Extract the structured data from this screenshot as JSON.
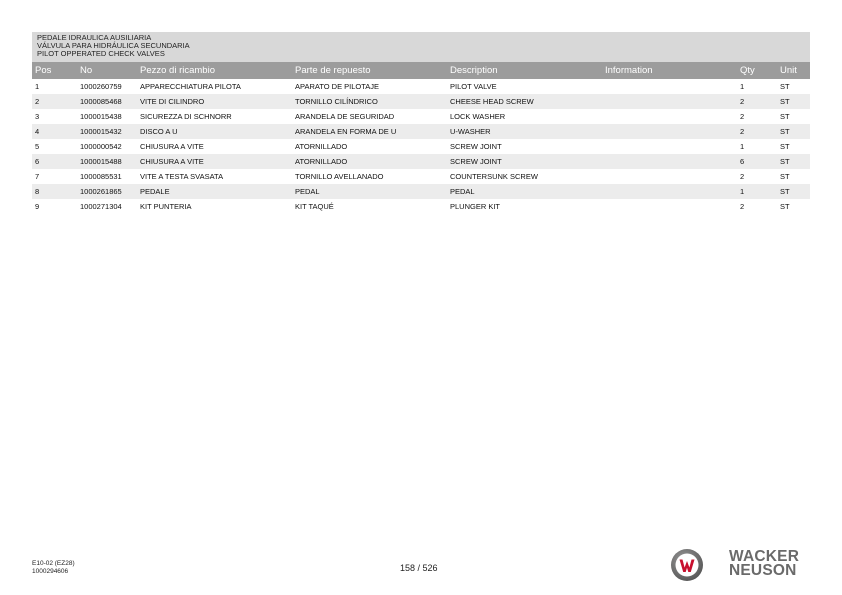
{
  "header": {
    "lines": [
      "PEDALE IDRAULICA AUSILIARIA",
      "VÁLVULA PARA HIDRÁULICA SECUNDARIA",
      "PILOT OPPERATED CHECK VALVES"
    ]
  },
  "table": {
    "columns": [
      "Pos",
      "No",
      "Pezzo di ricambio",
      "Parte de repuesto",
      "Description",
      "Information",
      "Qty",
      "Unit"
    ],
    "rows": [
      {
        "pos": "1",
        "no": "1000260759",
        "it": "APPARECCHIATURA PILOTA",
        "es": "APARATO DE PILOTAJE",
        "en": "PILOT VALVE",
        "info": "",
        "qty": "1",
        "unit": "ST"
      },
      {
        "pos": "2",
        "no": "1000085468",
        "it": "VITE DI CILINDRO",
        "es": "TORNILLO CILÍNDRICO",
        "en": "CHEESE HEAD SCREW",
        "info": "",
        "qty": "2",
        "unit": "ST"
      },
      {
        "pos": "3",
        "no": "1000015438",
        "it": "SICUREZZA DI SCHNORR",
        "es": "ARANDELA DE SEGURIDAD",
        "en": "LOCK WASHER",
        "info": "",
        "qty": "2",
        "unit": "ST"
      },
      {
        "pos": "4",
        "no": "1000015432",
        "it": "DISCO A U",
        "es": "ARANDELA EN FORMA DE U",
        "en": "U-WASHER",
        "info": "",
        "qty": "2",
        "unit": "ST"
      },
      {
        "pos": "5",
        "no": "1000000542",
        "it": "CHIUSURA A VITE",
        "es": "ATORNILLADO",
        "en": "SCREW JOINT",
        "info": "",
        "qty": "1",
        "unit": "ST"
      },
      {
        "pos": "6",
        "no": "1000015488",
        "it": "CHIUSURA A VITE",
        "es": "ATORNILLADO",
        "en": "SCREW JOINT",
        "info": "",
        "qty": "6",
        "unit": "ST"
      },
      {
        "pos": "7",
        "no": "1000085531",
        "it": "VITE A TESTA SVASATA",
        "es": "TORNILLO AVELLANADO",
        "en": "COUNTERSUNK SCREW",
        "info": "",
        "qty": "2",
        "unit": "ST"
      },
      {
        "pos": "8",
        "no": "1000261865",
        "it": "PEDALE",
        "es": "PEDAL",
        "en": "PEDAL",
        "info": "",
        "qty": "1",
        "unit": "ST"
      },
      {
        "pos": "9",
        "no": "1000271304",
        "it": "KIT PUNTERIA",
        "es": "KIT TAQUÉ",
        "en": "PLUNGER KIT",
        "info": "",
        "qty": "2",
        "unit": "ST"
      }
    ]
  },
  "footer": {
    "model": "E10-02 (EZ28)",
    "doc_number": "1000294606",
    "page": "158 / 526"
  },
  "logo": {
    "line1": "WACKER",
    "line2": "NEUSON",
    "icon": "wacker-neuson-w-logo",
    "color_red": "#c8102e",
    "color_grey": "#6a6a6a"
  }
}
